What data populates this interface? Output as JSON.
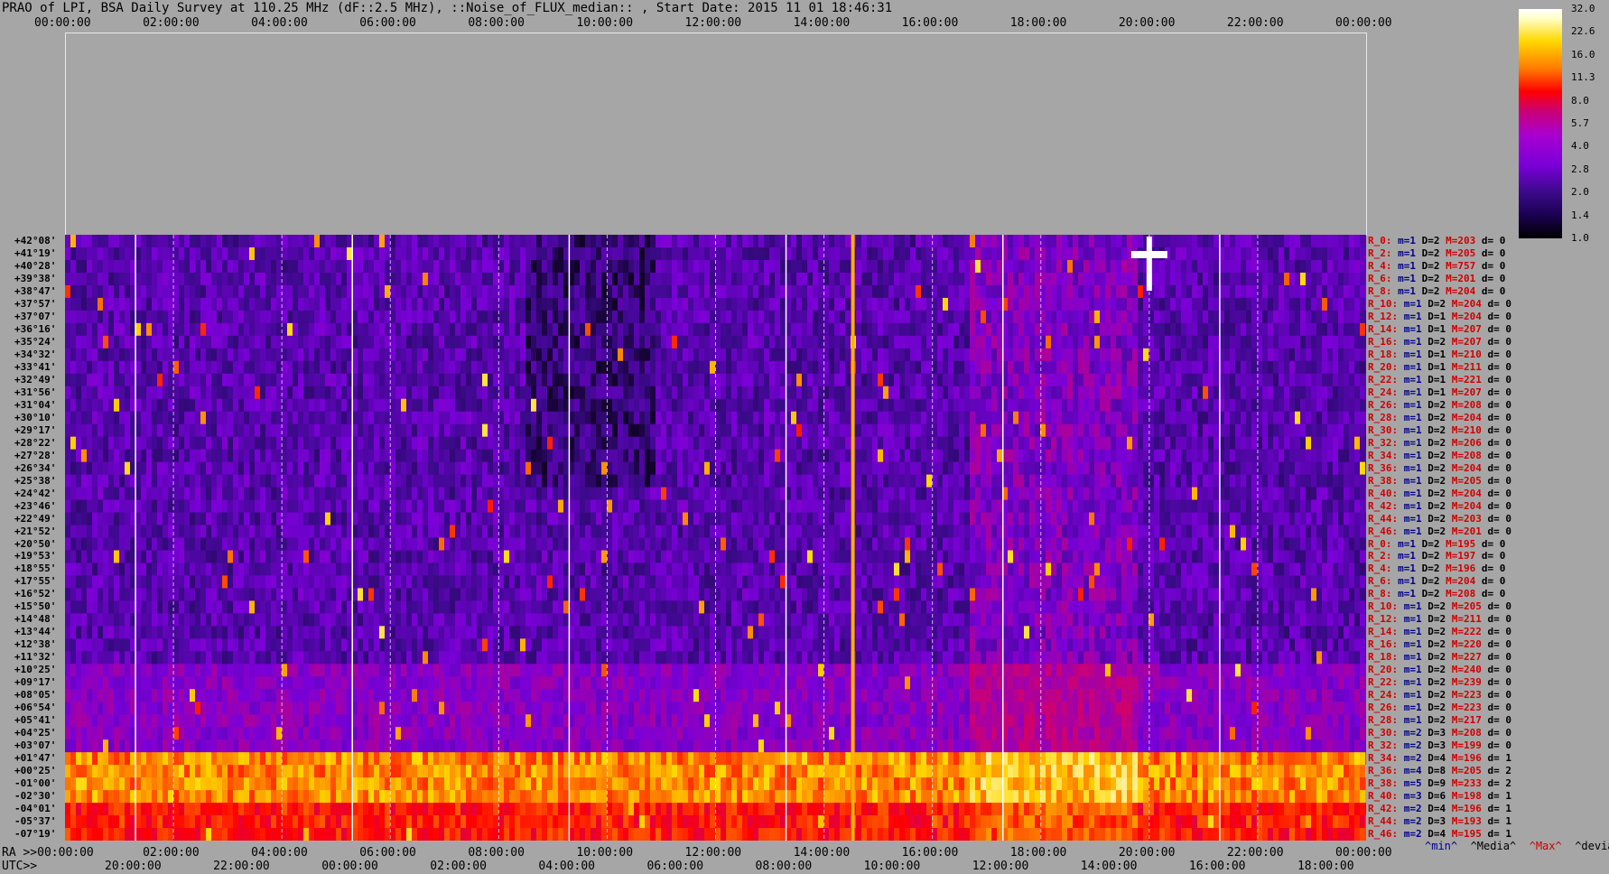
{
  "title": "PRAO of LPI, BSA Daily Survey at 110.25 MHz (dF::2.5 MHz), ::Noise_of_FLUX_median:: , Start Date: 2015 11 01 18:46:31",
  "chart_data": {
    "type": "heatmap",
    "title": "PRAO of LPI, BSA Daily Survey at 110.25 MHz (dF::2.5 MHz), ::Noise_of_FLUX_median:: , Start Date: 2015 11 01 18:46:31",
    "x_top_ticks": [
      "00:00:00",
      "02:00:00",
      "04:00:00",
      "06:00:00",
      "08:00:00",
      "10:00:00",
      "12:00:00",
      "14:00:00",
      "16:00:00",
      "18:00:00",
      "20:00:00",
      "22:00:00",
      "00:00:00"
    ],
    "ra_label": "RA >>00:00:00",
    "ra_ticks": [
      "02:00:00",
      "04:00:00",
      "06:00:00",
      "08:00:00",
      "10:00:00",
      "12:00:00",
      "14:00:00",
      "16:00:00",
      "18:00:00",
      "20:00:00",
      "22:00:00",
      "00:00:00"
    ],
    "utc_label": "UTC>>",
    "utc_ticks": [
      "20:00:00",
      "22:00:00",
      "00:00:00",
      "02:00:00",
      "04:00:00",
      "06:00:00",
      "08:00:00",
      "10:00:00",
      "12:00:00",
      "14:00:00",
      "16:00:00",
      "18:00:00"
    ],
    "declinations": [
      "+42°08'",
      "+41°19'",
      "+40°28'",
      "+39°38'",
      "+38°47'",
      "+37°57'",
      "+37°07'",
      "+36°16'",
      "+35°24'",
      "+34°32'",
      "+33°41'",
      "+32°49'",
      "+31°56'",
      "+31°04'",
      "+30°10'",
      "+29°17'",
      "+28°22'",
      "+27°28'",
      "+26°34'",
      "+25°38'",
      "+24°42'",
      "+23°46'",
      "+22°49'",
      "+21°52'",
      "+20°50'",
      "+19°53'",
      "+18°55'",
      "+17°55'",
      "+16°52'",
      "+15°50'",
      "+14°48'",
      "+13°44'",
      "+12°38'",
      "+11°32'",
      "+10°25'",
      "+09°17'",
      "+08°05'",
      "+06°54'",
      "+05°41'",
      "+04°25'",
      "+03°07'",
      "+01°47'",
      "+00°25'",
      "-01°00'",
      "-02°30'",
      "-04°01'",
      "-05°37'",
      "-07°19'"
    ],
    "colorbar": {
      "ticks": [
        "32.0",
        "22.6",
        "16.0",
        "11.3",
        "8.0",
        "5.7",
        "4.0",
        "2.8",
        "2.0",
        "1.4",
        "1.0"
      ],
      "colors": [
        "#000000",
        "#3b0a8a",
        "#7a00d8",
        "#c8007a",
        "#ff0000",
        "#ff7a00",
        "#ffd800",
        "#ffffff"
      ]
    },
    "row_params": [
      {
        "r": "R_0:",
        "m": "m=1",
        "D": "D=2",
        "M": "M=203",
        "d": "d= 0"
      },
      {
        "r": "R_2:",
        "m": "m=1",
        "D": "D=2",
        "M": "M=205",
        "d": "d= 0"
      },
      {
        "r": "R_4:",
        "m": "m=1",
        "D": "D=2",
        "M": "M=757",
        "d": "d= 0"
      },
      {
        "r": "R_6:",
        "m": "m=1",
        "D": "D=2",
        "M": "M=201",
        "d": "d= 0"
      },
      {
        "r": "R_8:",
        "m": "m=1",
        "D": "D=2",
        "M": "M=204",
        "d": "d= 0"
      },
      {
        "r": "R_10:",
        "m": "m=1",
        "D": "D=2",
        "M": "M=204",
        "d": "d= 0"
      },
      {
        "r": "R_12:",
        "m": "m=1",
        "D": "D=1",
        "M": "M=204",
        "d": "d= 0"
      },
      {
        "r": "R_14:",
        "m": "m=1",
        "D": "D=1",
        "M": "M=207",
        "d": "d= 0"
      },
      {
        "r": "R_16:",
        "m": "m=1",
        "D": "D=2",
        "M": "M=207",
        "d": "d= 0"
      },
      {
        "r": "R_18:",
        "m": "m=1",
        "D": "D=1",
        "M": "M=210",
        "d": "d= 0"
      },
      {
        "r": "R_20:",
        "m": "m=1",
        "D": "D=1",
        "M": "M=211",
        "d": "d= 0"
      },
      {
        "r": "R_22:",
        "m": "m=1",
        "D": "D=1",
        "M": "M=221",
        "d": "d= 0"
      },
      {
        "r": "R_24:",
        "m": "m=1",
        "D": "D=1",
        "M": "M=207",
        "d": "d= 0"
      },
      {
        "r": "R_26:",
        "m": "m=1",
        "D": "D=2",
        "M": "M=208",
        "d": "d= 0"
      },
      {
        "r": "R_28:",
        "m": "m=1",
        "D": "D=2",
        "M": "M=204",
        "d": "d= 0"
      },
      {
        "r": "R_30:",
        "m": "m=1",
        "D": "D=2",
        "M": "M=210",
        "d": "d= 0"
      },
      {
        "r": "R_32:",
        "m": "m=1",
        "D": "D=2",
        "M": "M=206",
        "d": "d= 0"
      },
      {
        "r": "R_34:",
        "m": "m=1",
        "D": "D=2",
        "M": "M=208",
        "d": "d= 0"
      },
      {
        "r": "R_36:",
        "m": "m=1",
        "D": "D=2",
        "M": "M=204",
        "d": "d= 0"
      },
      {
        "r": "R_38:",
        "m": "m=1",
        "D": "D=2",
        "M": "M=205",
        "d": "d= 0"
      },
      {
        "r": "R_40:",
        "m": "m=1",
        "D": "D=2",
        "M": "M=204",
        "d": "d= 0"
      },
      {
        "r": "R_42:",
        "m": "m=1",
        "D": "D=2",
        "M": "M=204",
        "d": "d= 0"
      },
      {
        "r": "R_44:",
        "m": "m=1",
        "D": "D=2",
        "M": "M=203",
        "d": "d= 0"
      },
      {
        "r": "R_46:",
        "m": "m=1",
        "D": "D=2",
        "M": "M=201",
        "d": "d= 0"
      },
      {
        "r": "R_0:",
        "m": "m=1",
        "D": "D=2",
        "M": "M=195",
        "d": "d= 0"
      },
      {
        "r": "R_2:",
        "m": "m=1",
        "D": "D=2",
        "M": "M=197",
        "d": "d= 0"
      },
      {
        "r": "R_4:",
        "m": "m=1",
        "D": "D=2",
        "M": "M=196",
        "d": "d= 0"
      },
      {
        "r": "R_6:",
        "m": "m=1",
        "D": "D=2",
        "M": "M=204",
        "d": "d= 0"
      },
      {
        "r": "R_8:",
        "m": "m=1",
        "D": "D=2",
        "M": "M=208",
        "d": "d= 0"
      },
      {
        "r": "R_10:",
        "m": "m=1",
        "D": "D=2",
        "M": "M=205",
        "d": "d= 0"
      },
      {
        "r": "R_12:",
        "m": "m=1",
        "D": "D=2",
        "M": "M=211",
        "d": "d= 0"
      },
      {
        "r": "R_14:",
        "m": "m=1",
        "D": "D=2",
        "M": "M=222",
        "d": "d= 0"
      },
      {
        "r": "R_16:",
        "m": "m=1",
        "D": "D=2",
        "M": "M=220",
        "d": "d= 0"
      },
      {
        "r": "R_18:",
        "m": "m=1",
        "D": "D=2",
        "M": "M=227",
        "d": "d= 0"
      },
      {
        "r": "R_20:",
        "m": "m=1",
        "D": "D=2",
        "M": "M=240",
        "d": "d= 0"
      },
      {
        "r": "R_22:",
        "m": "m=1",
        "D": "D=2",
        "M": "M=239",
        "d": "d= 0"
      },
      {
        "r": "R_24:",
        "m": "m=1",
        "D": "D=2",
        "M": "M=223",
        "d": "d= 0"
      },
      {
        "r": "R_26:",
        "m": "m=1",
        "D": "D=2",
        "M": "M=223",
        "d": "d= 0"
      },
      {
        "r": "R_28:",
        "m": "m=1",
        "D": "D=2",
        "M": "M=217",
        "d": "d= 0"
      },
      {
        "r": "R_30:",
        "m": "m=2",
        "D": "D=3",
        "M": "M=208",
        "d": "d= 0"
      },
      {
        "r": "R_32:",
        "m": "m=2",
        "D": "D=3",
        "M": "M=199",
        "d": "d= 0"
      },
      {
        "r": "R_34:",
        "m": "m=2",
        "D": "D=4",
        "M": "M=196",
        "d": "d= 1"
      },
      {
        "r": "R_36:",
        "m": "m=4",
        "D": "D=8",
        "M": "M=205",
        "d": "d= 2"
      },
      {
        "r": "R_38:",
        "m": "m=5",
        "D": "D=9",
        "M": "M=233",
        "d": "d= 2"
      },
      {
        "r": "R_40:",
        "m": "m=3",
        "D": "D=6",
        "M": "M=198",
        "d": "d= 1"
      },
      {
        "r": "R_42:",
        "m": "m=2",
        "D": "D=4",
        "M": "M=196",
        "d": "d= 1"
      },
      {
        "r": "R_44:",
        "m": "m=2",
        "D": "D=3",
        "M": "M=193",
        "d": "d= 1"
      },
      {
        "r": "R_46:",
        "m": "m=2",
        "D": "D=4",
        "M": "M=195",
        "d": "d= 1"
      }
    ],
    "legend_bottom": [
      "^min^",
      "^Media^",
      "^Max^",
      "^devia^"
    ]
  }
}
